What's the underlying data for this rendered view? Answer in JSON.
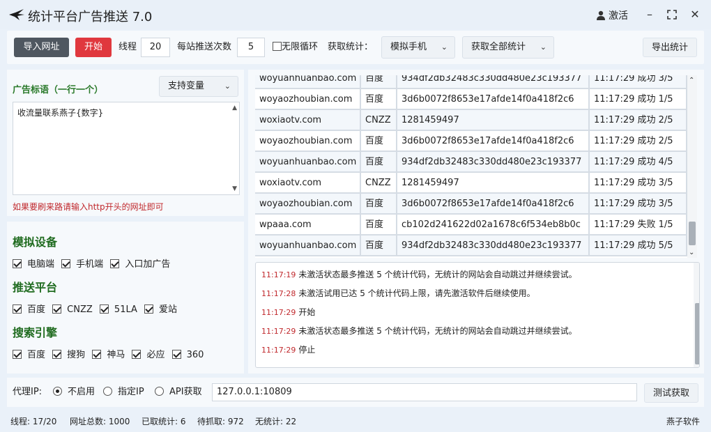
{
  "window": {
    "title": "统计平台广告推送 7.0",
    "user_label": "激活"
  },
  "toolbar": {
    "import_label": "导入网址",
    "start_label": "开始",
    "threads_label": "线程",
    "threads_value": "20",
    "per_site_label": "每站推送次数",
    "per_site_value": "5",
    "loop_label": "无限循环",
    "loop_checked": false,
    "fetch_label": "获取统计：",
    "device_select": "模拟手机",
    "fetch_all_select": "获取全部统计",
    "export_label": "导出统计"
  },
  "ad_panel": {
    "title": "广告标语（一行一个）",
    "variable_select": "支持变量",
    "text": "收流量联系燕子{数字}",
    "hint": "如果要刷来路请输入http开头的网址即可"
  },
  "options": {
    "device": {
      "title": "模拟设备",
      "items": [
        {
          "label": "电脑端",
          "checked": true
        },
        {
          "label": "手机端",
          "checked": true
        },
        {
          "label": "入口加广告",
          "checked": true
        }
      ]
    },
    "platform": {
      "title": "推送平台",
      "items": [
        {
          "label": "百度",
          "checked": true
        },
        {
          "label": "CNZZ",
          "checked": true
        },
        {
          "label": "51LA",
          "checked": true
        },
        {
          "label": "爱站",
          "checked": true
        }
      ]
    },
    "engine": {
      "title": "搜索引擎",
      "items": [
        {
          "label": "百度",
          "checked": true
        },
        {
          "label": "搜狗",
          "checked": true
        },
        {
          "label": "神马",
          "checked": true
        },
        {
          "label": "必应",
          "checked": true
        },
        {
          "label": "360",
          "checked": true
        }
      ]
    }
  },
  "results": {
    "rows": [
      [
        "woyuanhuanbao.com",
        "百度",
        "934df2db32483c330dd480e23c193377",
        "11:17:29 成功 3/5"
      ],
      [
        "woyaozhoubian.com",
        "百度",
        "3d6b0072f8653e17afde14f0a418f2c6",
        "11:17:29 成功 1/5"
      ],
      [
        "woxiaotv.com",
        "CNZZ",
        "1281459497",
        "11:17:29 成功 2/5"
      ],
      [
        "woyaozhoubian.com",
        "百度",
        "3d6b0072f8653e17afde14f0a418f2c6",
        "11:17:29 成功 2/5"
      ],
      [
        "woyuanhuanbao.com",
        "百度",
        "934df2db32483c330dd480e23c193377",
        "11:17:29 成功 4/5"
      ],
      [
        "woxiaotv.com",
        "CNZZ",
        "1281459497",
        "11:17:29 成功 3/5"
      ],
      [
        "woyaozhoubian.com",
        "百度",
        "3d6b0072f8653e17afde14f0a418f2c6",
        "11:17:29 成功 3/5"
      ],
      [
        "wpaaa.com",
        "百度",
        "cb102d241622d02a1678c6f534eb8b0c",
        "11:17:29 失败 1/5"
      ],
      [
        "woyuanhuanbao.com",
        "百度",
        "934df2db32483c330dd480e23c193377",
        "11:17:29 成功 5/5"
      ]
    ]
  },
  "log": {
    "lines": [
      {
        "time": "11:17:19",
        "text": "未激活状态最多推送 5 个统计代码，无统计的网站会自动跳过并继续尝试。"
      },
      {
        "time": "11:17:28",
        "text": "未激活试用已达 5 个统计代码上限，请先激活软件后继续使用。"
      },
      {
        "time": "11:17:29",
        "text": "开始"
      },
      {
        "time": "11:17:29",
        "text": "未激活状态最多推送 5 个统计代码，无统计的网站会自动跳过并继续尝试。"
      },
      {
        "time": "11:17:29",
        "text": "停止"
      }
    ]
  },
  "proxy": {
    "label": "代理IP:",
    "options": [
      "不启用",
      "指定IP",
      "API获取"
    ],
    "selected": "不启用",
    "value": "127.0.0.1:10809",
    "test_label": "测试获取"
  },
  "statusbar": {
    "threads": "线程: 17/20",
    "total": "网址总数: 1000",
    "fetched": "已取统计: 6",
    "pending": "待抓取: 972",
    "none": "无统计: 22",
    "brand": "燕子软件"
  },
  "colors": {
    "accent_red": "#e0383e",
    "title_green": "#1f6b1f",
    "log_time": "#c0282c"
  }
}
